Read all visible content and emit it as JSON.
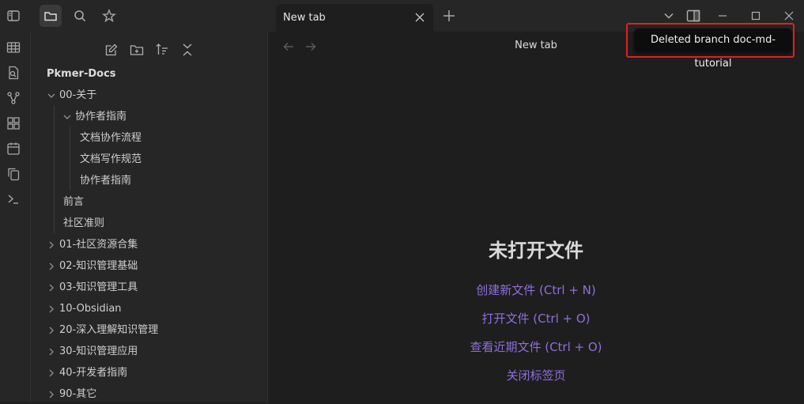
{
  "tab": {
    "title": "New tab"
  },
  "view": {
    "title": "New tab"
  },
  "sidebar": {
    "vault_name": "Pkmer-Docs",
    "tree": [
      {
        "label": "00-关于",
        "level": 0,
        "expanded": true,
        "folder": true
      },
      {
        "label": "协作者指南",
        "level": 1,
        "expanded": true,
        "folder": true
      },
      {
        "label": "文档协作流程",
        "level": 2,
        "folder": false
      },
      {
        "label": "文档写作规范",
        "level": 2,
        "folder": false
      },
      {
        "label": "协作者指南",
        "level": 2,
        "folder": false
      },
      {
        "label": "前言",
        "level": 1,
        "folder": false
      },
      {
        "label": "社区准则",
        "level": 1,
        "folder": false
      },
      {
        "label": "01-社区资源合集",
        "level": 0,
        "expanded": false,
        "folder": true
      },
      {
        "label": "02-知识管理基础",
        "level": 0,
        "expanded": false,
        "folder": true
      },
      {
        "label": "03-知识管理工具",
        "level": 0,
        "expanded": false,
        "folder": true
      },
      {
        "label": "10-Obsidian",
        "level": 0,
        "expanded": false,
        "folder": true
      },
      {
        "label": "20-深入理解知识管理",
        "level": 0,
        "expanded": false,
        "folder": true
      },
      {
        "label": "30-知识管理应用",
        "level": 0,
        "expanded": false,
        "folder": true
      },
      {
        "label": "40-开发者指南",
        "level": 0,
        "expanded": false,
        "folder": true
      },
      {
        "label": "90-其它",
        "level": 0,
        "expanded": false,
        "folder": true
      }
    ]
  },
  "empty_state": {
    "title": "未打开文件",
    "actions": [
      {
        "label": "创建新文件 (Ctrl + N)"
      },
      {
        "label": "打开文件 (Ctrl + O)"
      },
      {
        "label": "查看近期文件 (Ctrl + O)"
      },
      {
        "label": "关闭标签页"
      }
    ]
  },
  "notice": {
    "text": "Deleted branch doc-md-tutorial"
  },
  "colors": {
    "accent_link": "#8f6fdc",
    "highlight_border": "#e0201f",
    "notice_bg": "#0d0d0d"
  },
  "icons": {
    "titlebar": [
      "sidebar-toggle-icon",
      "folder-icon",
      "search-icon",
      "star-icon"
    ],
    "ribbon": [
      "table-icon",
      "file-search-icon",
      "graph-icon",
      "grid-icon",
      "calendar-icon",
      "copy-icon",
      "terminal-icon"
    ],
    "sidebar_tools": [
      "new-note-icon",
      "new-folder-icon",
      "sort-icon",
      "collapse-all-icon"
    ]
  }
}
